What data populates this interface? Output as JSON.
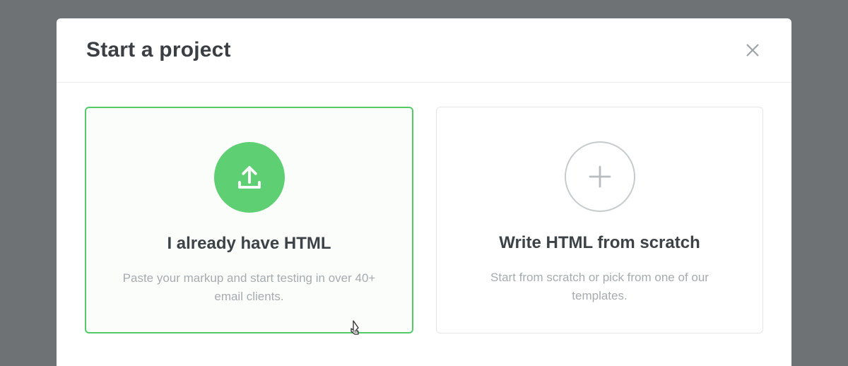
{
  "modal": {
    "title": "Start a project",
    "options": [
      {
        "title": "I already have HTML",
        "description": "Paste your markup and start testing in over 40+ email clients."
      },
      {
        "title": "Write HTML from scratch",
        "description": "Start from scratch or pick from one of our templates."
      }
    ]
  },
  "colors": {
    "accent": "#5fcf73",
    "accentBorder": "#53c96a",
    "textPrimary": "#3b3f43",
    "textMuted": "#a6abae",
    "overlay": "#6e7275"
  }
}
